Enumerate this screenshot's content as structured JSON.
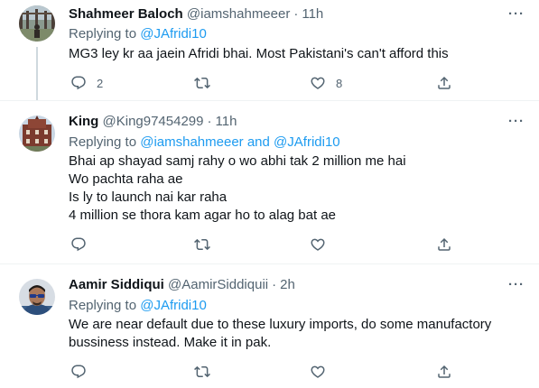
{
  "tweets": [
    {
      "name": "Shahmeer Baloch",
      "handle": "@iamshahmeeer",
      "dot": "·",
      "time": "11h",
      "replying_prefix": "Replying to ",
      "replying_links": [
        "@JAfridi10"
      ],
      "replying_joiner": "",
      "lines": [
        "MG3 ley kr aa jaein Afridi bhai. Most Pakistani's can't afford this"
      ],
      "reply_count": "2",
      "retweet_count": "",
      "like_count": "8"
    },
    {
      "name": "King",
      "handle": "@King97454299",
      "dot": "·",
      "time": "11h",
      "replying_prefix": "Replying to ",
      "replying_links": [
        "@iamshahmeeer",
        "@JAfridi10"
      ],
      "replying_joiner": " and ",
      "lines": [
        "Bhai ap shayad samj rahy o wo abhi tak 2 million me hai",
        "Wo pachta raha ae",
        "Is ly to launch nai kar raha",
        "4 million se thora kam agar ho to alag bat ae"
      ],
      "reply_count": "",
      "retweet_count": "",
      "like_count": ""
    },
    {
      "name": "Aamir Siddiqui",
      "handle": "@AamirSiddiquii",
      "dot": "·",
      "time": "2h",
      "replying_prefix": "Replying to ",
      "replying_links": [
        "@JAfridi10"
      ],
      "replying_joiner": "",
      "lines": [
        "We are near default due to these luxury imports, do some manufactory",
        "bussiness instead. Make it in pak."
      ],
      "reply_count": "",
      "retweet_count": "",
      "like_count": ""
    }
  ],
  "more_label": "···",
  "icons": {
    "reply": "reply-icon",
    "retweet": "retweet-icon",
    "like": "heart-icon",
    "share": "share-icon",
    "more": "more-icon"
  },
  "colors": {
    "text": "#0f1419",
    "secondary": "#536471",
    "link": "#1d9bf0",
    "divider": "#eff3f4",
    "thread_line": "#cfd9de"
  }
}
